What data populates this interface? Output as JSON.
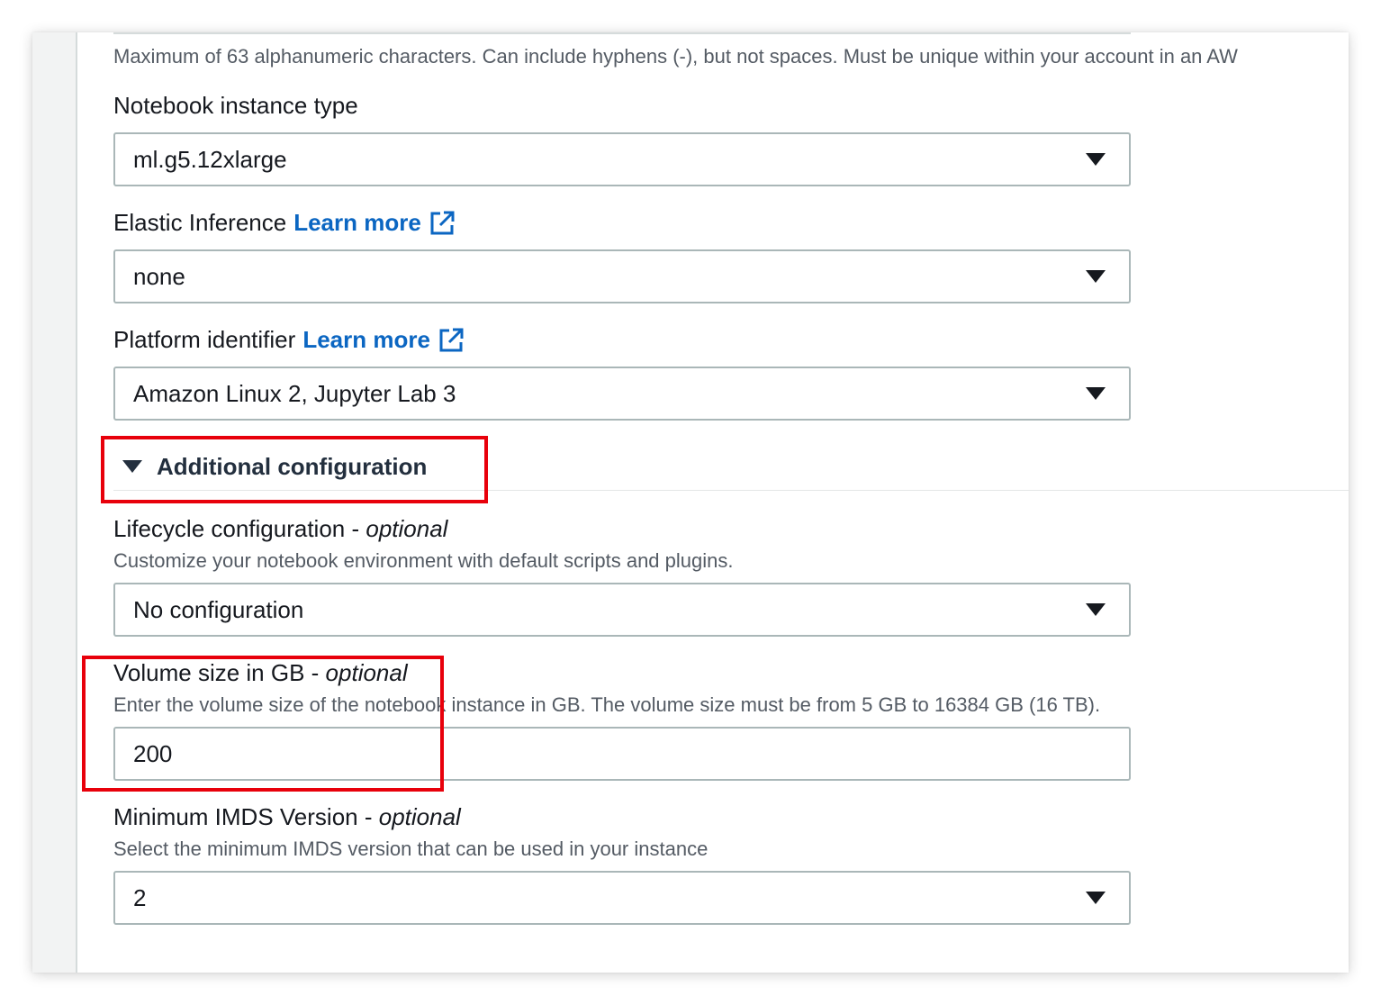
{
  "name_hint": "Maximum of 63 alphanumeric characters. Can include hyphens (-), but not spaces. Must be unique within your account in an AW",
  "instance_type": {
    "label": "Notebook instance type",
    "value": "ml.g5.12xlarge"
  },
  "elastic_inference": {
    "label": "Elastic Inference",
    "link": "Learn more",
    "value": "none"
  },
  "platform": {
    "label": "Platform identifier",
    "link": "Learn more",
    "value": "Amazon Linux 2, Jupyter Lab 3"
  },
  "additional_config": {
    "label": "Additional configuration"
  },
  "lifecycle": {
    "label": "Lifecycle configuration - ",
    "optional": "optional",
    "hint": "Customize your notebook environment with default scripts and plugins.",
    "value": "No configuration"
  },
  "volume": {
    "label": "Volume size in GB - ",
    "optional": "optional",
    "hint": "Enter the volume size of the notebook instance in GB. The volume size must be from 5 GB to 16384 GB (16 TB).",
    "value": "200"
  },
  "imds": {
    "label": "Minimum IMDS Version - ",
    "optional": "optional",
    "hint": "Select the minimum IMDS version that can be used in your instance",
    "value": "2"
  },
  "colors": {
    "link": "#0b66c2",
    "highlight": "#e8000b",
    "field_border": "#aab7b8"
  }
}
